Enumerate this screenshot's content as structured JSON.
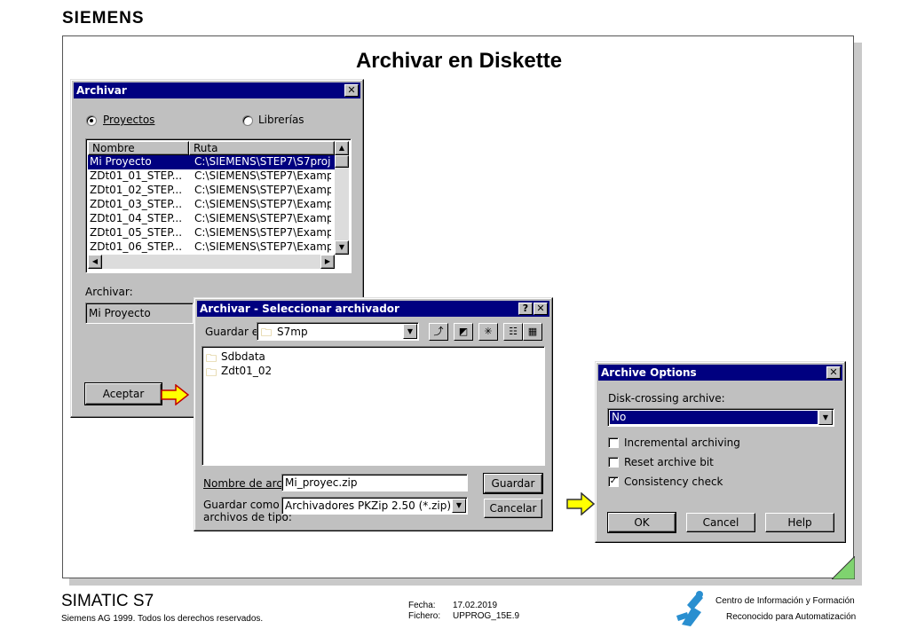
{
  "brand": "SIEMENS",
  "slide_title": "Archivar en Diskette",
  "archivar_dialog": {
    "title": "Archivar",
    "close": "✕",
    "radio_projects": "Proyectos",
    "radio_libraries": "Librerías",
    "col_name": "Nombre",
    "col_path": "Ruta",
    "rows": [
      {
        "name": "Mi Proyecto",
        "path": "C:\\SIEMENS\\STEP7\\S7proj"
      },
      {
        "name": "ZDt01_01_STEP...",
        "path": "C:\\SIEMENS\\STEP7\\Examp"
      },
      {
        "name": "ZDt01_02_STEP...",
        "path": "C:\\SIEMENS\\STEP7\\Examp"
      },
      {
        "name": "ZDt01_03_STEP...",
        "path": "C:\\SIEMENS\\STEP7\\Examp"
      },
      {
        "name": "ZDt01_04_STEP...",
        "path": "C:\\SIEMENS\\STEP7\\Examp"
      },
      {
        "name": "ZDt01_05_STEP...",
        "path": "C:\\SIEMENS\\STEP7\\Examp"
      },
      {
        "name": "ZDt01_06_STEP...",
        "path": "C:\\SIEMENS\\STEP7\\Examp"
      }
    ],
    "archive_label": "Archivar:",
    "archive_value": "Mi Proyecto",
    "accept": "Aceptar"
  },
  "select_dialog": {
    "title": "Archivar - Seleccionar archivador",
    "help": "?",
    "close": "✕",
    "save_in_label": "Guardar en:",
    "save_in_value": "S7mp",
    "files": [
      "Sdbdata",
      "Zdt01_02"
    ],
    "filename_label": "Nombre de archivo:",
    "filename_value": "Mi_proyec.zip",
    "type_label_1": "Guardar como",
    "type_label_2": "archivos de tipo:",
    "type_value": "Archivadores PKZip 2.50 (*.zip)",
    "save": "Guardar",
    "cancel": "Cancelar"
  },
  "options_dialog": {
    "title": "Archive Options",
    "close": "✕",
    "disk_label": "Disk-crossing archive:",
    "disk_value": "No",
    "incremental": "Incremental archiving",
    "reset": "Reset archive bit",
    "consistency": "Consistency check",
    "check_mark": "✓",
    "ok": "OK",
    "cancel": "Cancel",
    "help": "Help"
  },
  "footer": {
    "product": "SIMATIC S7",
    "copyright": "Siemens AG 1999. Todos los derechos reservados.",
    "date_label": "Fecha:",
    "date_value": "17.02.2019",
    "file_label": "Fichero:",
    "file_value": "UPPROG_15E.9",
    "center_line1": "Centro de Información y Formación",
    "center_line2": "Reconocido para Automatización"
  },
  "colors": {
    "titlebar": "#000080",
    "arrow_fill": "#ffff00",
    "arrow_outline": "#c00000",
    "corner": "#7fd36f"
  }
}
